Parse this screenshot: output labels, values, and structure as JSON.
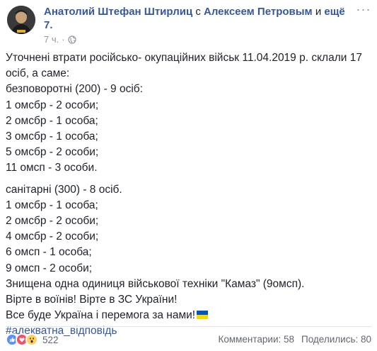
{
  "post": {
    "author": "Анатолий Штефан Штирлиц",
    "with_word": "с",
    "tagged_person": "Алексеем Петровым",
    "and_word": "и",
    "others": "ещё 7.",
    "time": "7 ч.",
    "lines_p1": [
      "Уточнені втрати російсько- окупаційних військ 11.04.2019 р. склали 17",
      "осіб, а саме:",
      "безповоротні (200) - 9 осіб:",
      "1 омсбр - 2 особи;",
      "2 омсбр - 1 особа;",
      "3 омсбр - 1 особа;",
      "5 омсбр - 2 особи;",
      "11 омсп - 3 особи."
    ],
    "lines_p2": [
      "санітарні (300) - 8 осіб.",
      "1 омсбр - 1 особа;",
      "2 омсбр - 2 особи;",
      "4 омсбр - 2 особи;",
      "6 омсп - 1 особа;",
      "9 омсп - 2 особи;",
      "Знищена одна одиниця військової техніки \"Камаз\" (9омсп).",
      "Вірте в воїнів! Вірте в ЗС України!"
    ],
    "last_line": "Все буде Україна і перемога за нами!",
    "hashtag": "#адекватна_відповідь"
  },
  "footer": {
    "reaction_count": "522",
    "comments": "Комментарии: 58",
    "shares": "Поделились: 80"
  },
  "icons": [
    "globe-icon",
    "more-options-icon",
    "like-reaction-icon",
    "love-reaction-icon",
    "wow-reaction-icon",
    "ukraine-flag-icon"
  ],
  "colors": {
    "link": "#365899",
    "text": "#1d2129",
    "meta": "#90949c",
    "flag_blue": "#0057b7",
    "flag_yellow": "#ffd700"
  }
}
